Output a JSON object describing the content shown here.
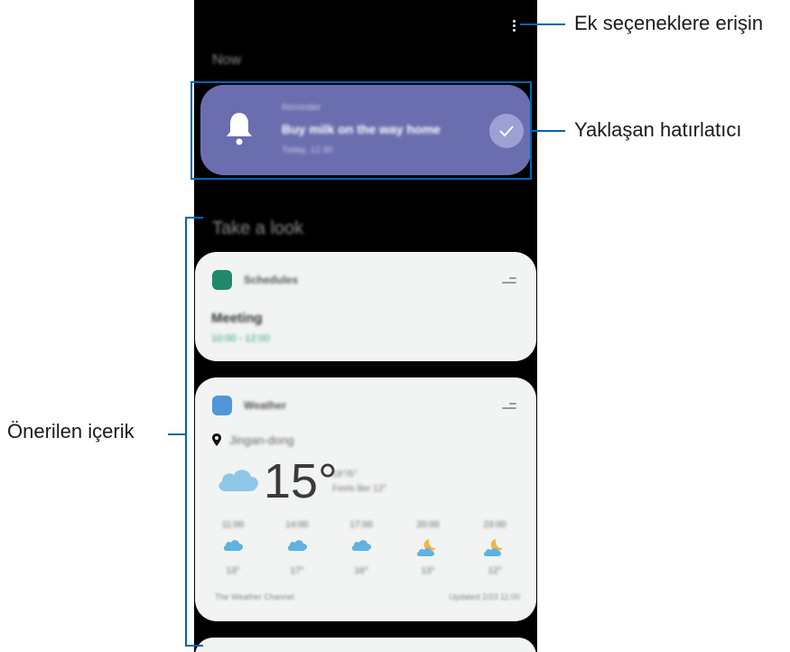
{
  "callouts": {
    "options": "Ek seçeneklere erişin",
    "reminder": "Yaklaşan hatırlatıcı",
    "suggested": "Önerilen içerik"
  },
  "screen": {
    "now_label": "Now",
    "take_a_look_label": "Take a look"
  },
  "reminder": {
    "category": "Reminder",
    "title": "Buy milk on the way home",
    "time": "Today, 12:30",
    "icon": "bell-icon",
    "color": "#6a6eaf"
  },
  "schedule_card": {
    "app_name": "Schedules",
    "event_title": "Meeting",
    "event_time": "10:00 - 12:00"
  },
  "weather_card": {
    "app_name": "Weather",
    "location": "Jingan-dong",
    "temperature": "15°",
    "high_low": "18°/5°",
    "feels_like": "Feels like 12°",
    "hourly": [
      {
        "hour": "11:00",
        "icon": "cloud-icon",
        "temp": "13°"
      },
      {
        "hour": "14:00",
        "icon": "cloud-icon",
        "temp": "17°"
      },
      {
        "hour": "17:00",
        "icon": "cloud-icon",
        "temp": "16°"
      },
      {
        "hour": "20:00",
        "icon": "moon-cloud-icon",
        "temp": "13°"
      },
      {
        "hour": "23:00",
        "icon": "moon-cloud-icon",
        "temp": "12°"
      }
    ],
    "source": "The Weather Channel",
    "updated": "Updated 2/23 11:00"
  }
}
